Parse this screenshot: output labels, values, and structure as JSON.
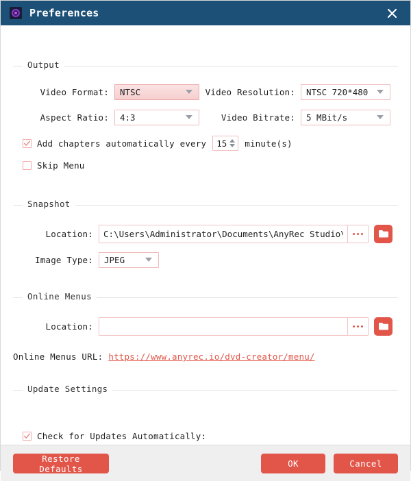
{
  "window": {
    "title": "Preferences",
    "app_icon": "target-icon",
    "close_icon": "close-icon",
    "titlebar_color": "#1d5077",
    "accent_color": "#e2564a"
  },
  "output": {
    "group_title": "Output",
    "video_format": {
      "label": "Video Format:",
      "value": "NTSC",
      "state": "hover"
    },
    "video_resolution": {
      "label": "Video Resolution:",
      "value": "NTSC 720*480"
    },
    "aspect_ratio": {
      "label": "Aspect Ratio:",
      "value": "4:3"
    },
    "video_bitrate": {
      "label": "Video Bitrate:",
      "value": "5 MBit/s"
    },
    "add_chapters": {
      "label": "Add chapters automatically every",
      "checked": true,
      "interval": "15",
      "suffix": "minute(s)"
    },
    "skip_menu": {
      "label": "Skip Menu",
      "checked": false
    }
  },
  "snapshot": {
    "group_title": "Snapshot",
    "location": {
      "label": "Location:",
      "value": "C:\\Users\\Administrator\\Documents\\AnyRec Studio\\",
      "placeholder": "",
      "browse_icon": "ellipsis-icon",
      "folder_icon": "folder-icon"
    },
    "image_type": {
      "label": "Image Type:",
      "value": "JPEG"
    }
  },
  "online_menus": {
    "group_title": "Online Menus",
    "location": {
      "label": "Location:",
      "value": "",
      "placeholder": "",
      "browse_icon": "ellipsis-icon",
      "folder_icon": "folder-icon"
    },
    "url_label": "Online Menus URL:",
    "url_value": "https://www.anyrec.io/dvd-creator/menu/"
  },
  "update_settings": {
    "group_title": "Update Settings",
    "check_updates": {
      "label": "Check for Updates Automatically:",
      "checked": true
    }
  },
  "footer": {
    "restore_label": "Restore Defaults",
    "ok_label": "OK",
    "cancel_label": "Cancel"
  }
}
